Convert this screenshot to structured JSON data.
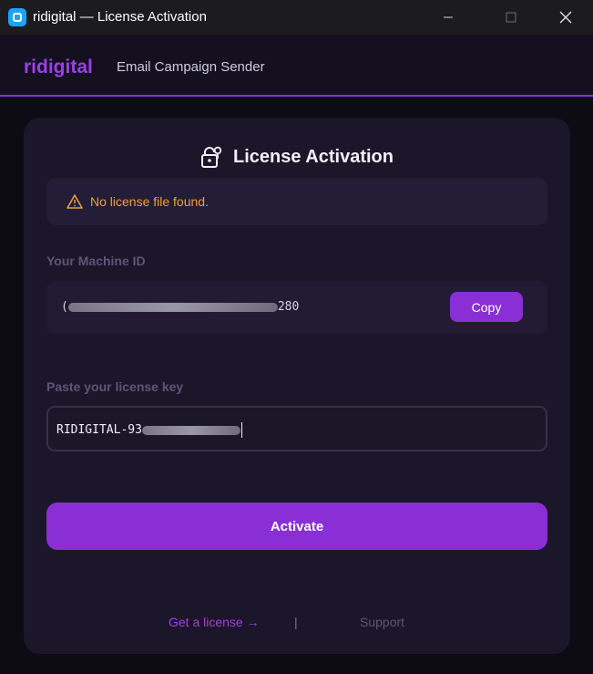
{
  "window": {
    "title": "ridigital — License Activation",
    "controls": {
      "minimize": "minimize-icon",
      "maximize": "maximize-icon",
      "close": "close-icon"
    }
  },
  "header": {
    "brand": "ridigital",
    "subtitle": "Email Campaign Sender"
  },
  "card": {
    "title": "License Activation",
    "title_icon": "lock-key-icon",
    "alert": {
      "icon": "warning-icon",
      "message": "No license file found."
    },
    "machine_id": {
      "label": "Your Machine ID",
      "prefix": "(",
      "suffix": "280",
      "copy_label": "Copy"
    },
    "license_key": {
      "label": "Paste your license key",
      "value_visible": "RIDIGITAL-93"
    },
    "activate_label": "Activate",
    "footer": {
      "get_license": "Get a license →",
      "separator": "|",
      "support": "Support"
    }
  },
  "colors": {
    "accent": "#8a2fd6",
    "brand": "#9d3ee6",
    "warning": "#e9a23b",
    "background": "#0d0b13",
    "card": "#1b1629"
  }
}
